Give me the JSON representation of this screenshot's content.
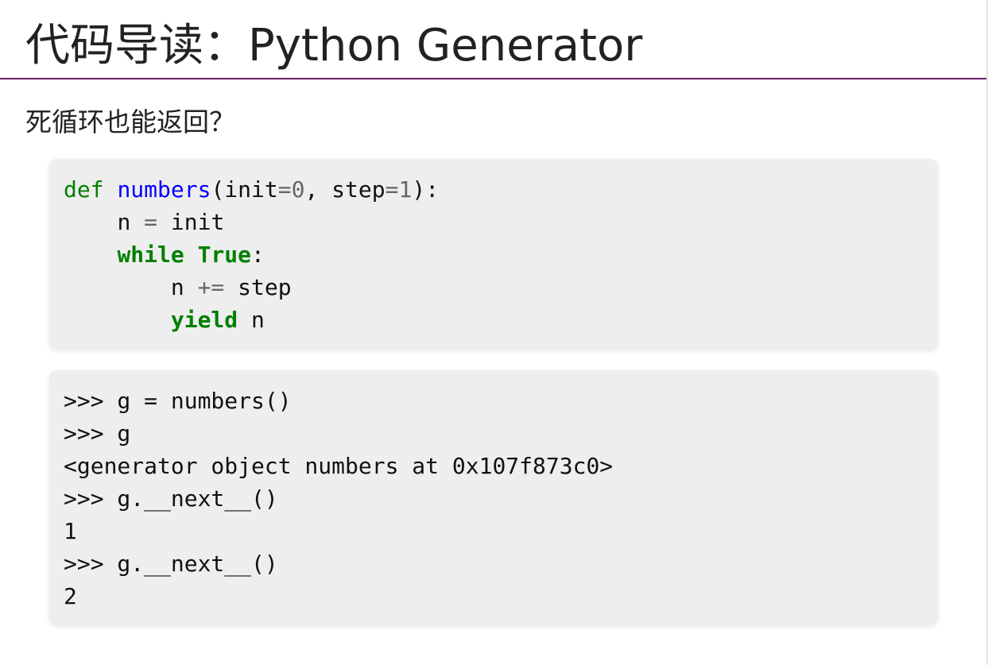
{
  "title": "代码导读：Python Generator",
  "section_heading": "死循环也能返回？",
  "def_code": {
    "line1": {
      "kw": "def",
      "sp": " ",
      "fn": "numbers",
      "p1": "(init",
      "op1": "=",
      "n1": "0",
      "p2": ", step",
      "op2": "=",
      "n2": "1",
      "p3": "):"
    },
    "line2": {
      "indent": "    ",
      "a": "n ",
      "op": "=",
      "b": " init"
    },
    "line3": {
      "indent": "    ",
      "kw1": "while",
      "sp": " ",
      "kw2": "True",
      "b": ":"
    },
    "line4": {
      "indent": "        ",
      "a": "n ",
      "op": "+=",
      "b": " step"
    },
    "line5": {
      "indent": "        ",
      "kw": "yield",
      "b": " n"
    }
  },
  "repl_lines": [
    ">>> g = numbers()",
    ">>> g",
    "<generator object numbers at 0x107f873c0>",
    ">>> g.__next__()",
    "1",
    ">>> g.__next__()",
    "2"
  ],
  "colors": {
    "keyword": "#008000",
    "function_name": "#0000ff",
    "operator": "#666666",
    "header_rule": "#6a1b6a",
    "code_background": "#eeeeee"
  }
}
